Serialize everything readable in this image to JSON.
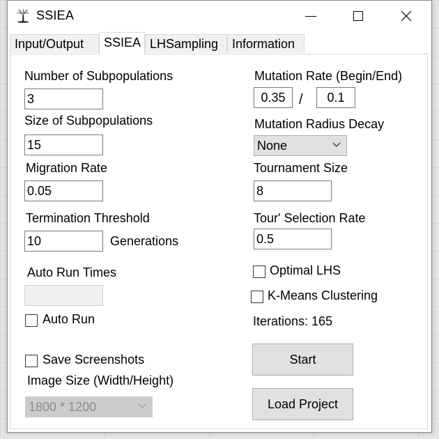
{
  "window": {
    "title": "SSIEA",
    "icon": "palm-tree-icon",
    "controls": [
      "minimize-icon",
      "maximize-icon",
      "close-icon"
    ]
  },
  "tabs": [
    {
      "label": "Input/Output",
      "active": false
    },
    {
      "label": "SSIEA",
      "active": true
    },
    {
      "label": "LHSampling",
      "active": false
    },
    {
      "label": "Information",
      "active": false
    }
  ],
  "left": {
    "num_subpop_label": "Number of Subpopulations",
    "num_subpop_value": "3",
    "size_subpop_label": "Size of Subpopulations",
    "size_subpop_value": "15",
    "migration_label": "Migration Rate",
    "migration_value": "0.05",
    "termination_label": "Termination Threshold",
    "termination_value": "10",
    "generations_label": "Generations",
    "auto_run_times_label": "Auto Run Times",
    "auto_run_times_value": "",
    "auto_run_label": "Auto Run",
    "auto_run_checked": false,
    "save_screenshots_label": "Save Screenshots",
    "save_screenshots_checked": false,
    "image_size_label": "Image Size (Width/Height)",
    "image_size_value": "1800 * 1200"
  },
  "right": {
    "mutation_rate_label": "Mutation Rate (Begin/End)",
    "mutation_begin": "0.35",
    "slash": "/",
    "mutation_end": "0.1",
    "mutation_decay_label": "Mutation Radius Decay",
    "mutation_decay_value": "None",
    "tournament_size_label": "Tournament Size",
    "tournament_size_value": "8",
    "tour_selection_label": "Tour' Selection Rate",
    "tour_selection_value": "0.5",
    "optimal_lhs_label": "Optimal LHS",
    "optimal_lhs_checked": false,
    "kmeans_label": "K-Means Clustering",
    "kmeans_checked": false,
    "iterations_text": "Iterations: 165",
    "start_label": "Start",
    "load_project_label": "Load Project"
  }
}
